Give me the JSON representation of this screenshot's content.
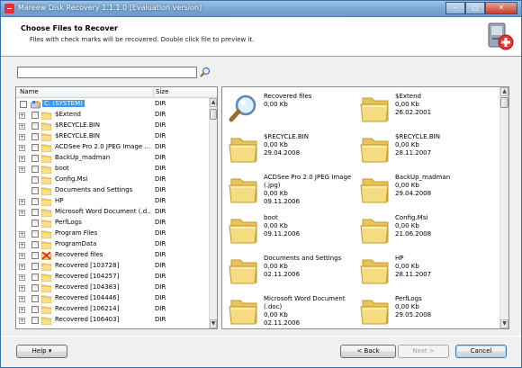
{
  "window": {
    "title": "Mareew Disk Recovery 1.1.1.0 [Evaluation version]"
  },
  "titlebar_buttons": [
    "–",
    "□",
    "✕"
  ],
  "header": {
    "title": "Choose Files to Recover",
    "subtitle": "Files with check marks will be recovered. Double click file to preview it."
  },
  "search": {
    "value": "",
    "placeholder": ""
  },
  "tree": {
    "columns": {
      "name": "Name",
      "size": "Size"
    },
    "rows": [
      {
        "label": "C: (SYSTEM)",
        "size": "DIR",
        "icon": "drive-icon",
        "level": 0,
        "expander": "",
        "selected": true
      },
      {
        "label": "$Extend",
        "size": "DIR",
        "icon": "folder-icon",
        "level": 1,
        "expander": "+"
      },
      {
        "label": "$RECYCLE.BIN",
        "size": "DIR",
        "icon": "folder-icon",
        "level": 1,
        "expander": "+"
      },
      {
        "label": "$RECYCLE.BIN",
        "size": "DIR",
        "icon": "folder-icon",
        "level": 1,
        "expander": "+"
      },
      {
        "label": "ACDSee Pro 2.0 JPEG Image ...",
        "size": "DIR",
        "icon": "folder-icon",
        "level": 1,
        "expander": "+"
      },
      {
        "label": "BackUp_madman",
        "size": "DIR",
        "icon": "folder-icon",
        "level": 1,
        "expander": "+"
      },
      {
        "label": "boot",
        "size": "DIR",
        "icon": "folder-icon",
        "level": 1,
        "expander": "+"
      },
      {
        "label": "Config.Msi",
        "size": "DIR",
        "icon": "folder-icon",
        "level": 1,
        "expander": ""
      },
      {
        "label": "Documents and Settings",
        "size": "DIR",
        "icon": "folder-icon",
        "level": 1,
        "expander": ""
      },
      {
        "label": "HP",
        "size": "DIR",
        "icon": "folder-icon",
        "level": 1,
        "expander": "+"
      },
      {
        "label": "Microsoft Word Document (.d...",
        "size": "DIR",
        "icon": "folder-icon",
        "level": 1,
        "expander": "+"
      },
      {
        "label": "PerfLogs",
        "size": "DIR",
        "icon": "folder-icon",
        "level": 1,
        "expander": ""
      },
      {
        "label": "Program Files",
        "size": "DIR",
        "icon": "folder-icon",
        "level": 1,
        "expander": "+"
      },
      {
        "label": "ProgramData",
        "size": "DIR",
        "icon": "folder-icon",
        "level": 1,
        "expander": "+"
      },
      {
        "label": "Recovered files",
        "size": "DIR",
        "icon": "deleted-folder-icon",
        "level": 1,
        "expander": "+"
      },
      {
        "label": "Recovered [103728]",
        "size": "DIR",
        "icon": "folder-icon",
        "level": 1,
        "expander": "+"
      },
      {
        "label": "Recovered [104257]",
        "size": "DIR",
        "icon": "folder-icon",
        "level": 1,
        "expander": "+"
      },
      {
        "label": "Recovered [104383]",
        "size": "DIR",
        "icon": "folder-icon",
        "level": 1,
        "expander": "+"
      },
      {
        "label": "Recovered [104446]",
        "size": "DIR",
        "icon": "folder-icon",
        "level": 1,
        "expander": "+"
      },
      {
        "label": "Recovered [106214]",
        "size": "DIR",
        "icon": "folder-icon",
        "level": 1,
        "expander": "+"
      },
      {
        "label": "Recovered [106403]",
        "size": "DIR",
        "icon": "folder-icon",
        "level": 1,
        "expander": "+"
      }
    ]
  },
  "files": [
    {
      "name": "Recovered files",
      "size": "0,00 Kb",
      "date": "",
      "icon": "magnifier-icon"
    },
    {
      "name": "$Extend",
      "size": "0,00 Kb",
      "date": "26.02.2001",
      "icon": "folder-icon"
    },
    {
      "name": "$RECYCLE.BIN",
      "size": "0,00 Kb",
      "date": "29.04.2008",
      "icon": "folder-icon"
    },
    {
      "name": "$RECYCLE.BIN",
      "size": "0,00 Kb",
      "date": "28.11.2007",
      "icon": "folder-icon"
    },
    {
      "name": "ACDSee Pro 2.0 JPEG Image",
      "name2": "(.jpg)",
      "size": "0,00 Kb",
      "date": "09.11.2006",
      "icon": "folder-icon"
    },
    {
      "name": "BackUp_madman",
      "size": "0,00 Kb",
      "date": "29.04.2008",
      "icon": "folder-icon"
    },
    {
      "name": "boot",
      "size": "0,00 Kb",
      "date": "09.11.2006",
      "icon": "folder-icon"
    },
    {
      "name": "Config.Msi",
      "size": "0,00 Kb",
      "date": "21.06.2008",
      "icon": "folder-icon"
    },
    {
      "name": "Documents and Settings",
      "size": "0,00 Kb",
      "date": "02.11.2006",
      "icon": "folder-icon"
    },
    {
      "name": "HP",
      "size": "0,00 Kb",
      "date": "28.11.2007",
      "icon": "folder-icon"
    },
    {
      "name": "Microsoft Word Document",
      "name2": "(.doc)",
      "size": "0,00 Kb",
      "date": "02.11.2006",
      "icon": "folder-icon"
    },
    {
      "name": "PerfLogs",
      "size": "0,00 Kb",
      "date": "29.05.2008",
      "icon": "folder-icon"
    },
    {
      "name": "Program Files",
      "size": "0,00 Kb",
      "date": "02.11.2006",
      "icon": "folder-icon"
    },
    {
      "name": "ProgramData",
      "size": "0,00 Kb",
      "date": "02.11.2006",
      "icon": "folder-icon"
    }
  ],
  "footer": {
    "help_label": "Help ▾",
    "back_label": "< Back",
    "next_label": "Next >",
    "cancel_label": "Cancel"
  },
  "colors": {
    "selection": "#3399ff",
    "folder": "#f3d46b",
    "titlebar": "#7aa9d6"
  }
}
